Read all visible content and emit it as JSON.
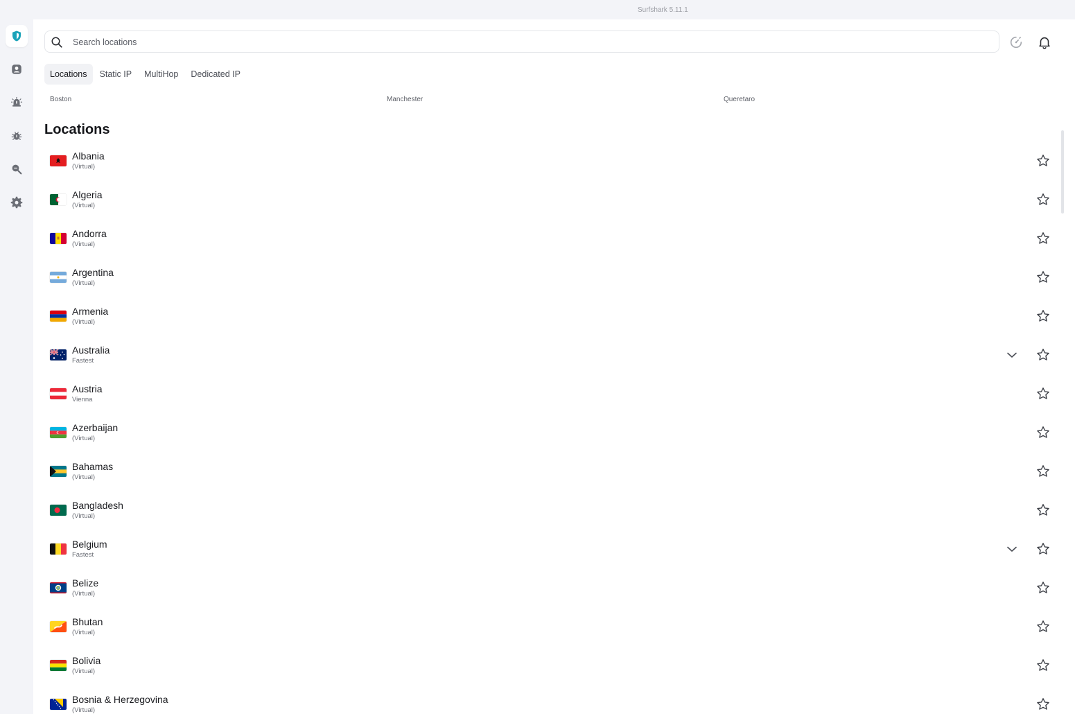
{
  "app": {
    "title": "Surfshark 5.11.1"
  },
  "sidebar": {
    "items": [
      {
        "name": "vpn-shield",
        "icon": "shield-icon",
        "active": true
      },
      {
        "name": "account",
        "icon": "account-icon",
        "active": false
      },
      {
        "name": "alert",
        "icon": "alert-icon",
        "active": false
      },
      {
        "name": "antivirus",
        "icon": "bug-icon",
        "active": false
      },
      {
        "name": "search-privacy",
        "icon": "search-zoom-icon",
        "active": false
      },
      {
        "name": "settings",
        "icon": "gear-icon",
        "active": false
      }
    ]
  },
  "search": {
    "placeholder": "Search locations",
    "value": ""
  },
  "tabs": [
    {
      "label": "Locations",
      "active": true
    },
    {
      "label": "Static IP",
      "active": false
    },
    {
      "label": "MultiHop",
      "active": false
    },
    {
      "label": "Dedicated IP",
      "active": false
    }
  ],
  "recent": [
    "Boston",
    "Manchester",
    "Queretaro"
  ],
  "section": {
    "title": "Locations"
  },
  "locations": [
    {
      "country": "Albania",
      "sub": "(Virtual)",
      "expandable": false,
      "flag": "albania"
    },
    {
      "country": "Algeria",
      "sub": "(Virtual)",
      "expandable": false,
      "flag": "algeria"
    },
    {
      "country": "Andorra",
      "sub": "(Virtual)",
      "expandable": false,
      "flag": "andorra"
    },
    {
      "country": "Argentina",
      "sub": "(Virtual)",
      "expandable": false,
      "flag": "argentina"
    },
    {
      "country": "Armenia",
      "sub": "(Virtual)",
      "expandable": false,
      "flag": "armenia"
    },
    {
      "country": "Australia",
      "sub": "Fastest",
      "expandable": true,
      "flag": "australia"
    },
    {
      "country": "Austria",
      "sub": "Vienna",
      "expandable": false,
      "flag": "austria"
    },
    {
      "country": "Azerbaijan",
      "sub": "(Virtual)",
      "expandable": false,
      "flag": "azerbaijan"
    },
    {
      "country": "Bahamas",
      "sub": "(Virtual)",
      "expandable": false,
      "flag": "bahamas"
    },
    {
      "country": "Bangladesh",
      "sub": "(Virtual)",
      "expandable": false,
      "flag": "bangladesh"
    },
    {
      "country": "Belgium",
      "sub": "Fastest",
      "expandable": true,
      "flag": "belgium"
    },
    {
      "country": "Belize",
      "sub": "(Virtual)",
      "expandable": false,
      "flag": "belize"
    },
    {
      "country": "Bhutan",
      "sub": "(Virtual)",
      "expandable": false,
      "flag": "bhutan"
    },
    {
      "country": "Bolivia",
      "sub": "(Virtual)",
      "expandable": false,
      "flag": "bolivia"
    },
    {
      "country": "Bosnia & Herzegovina",
      "sub": "(Virtual)",
      "expandable": false,
      "flag": "bosnia"
    }
  ],
  "colors": {
    "accent": "#1ba3b9",
    "sidebar_icon": "#6b6e76",
    "background": "#f3f4f8"
  }
}
